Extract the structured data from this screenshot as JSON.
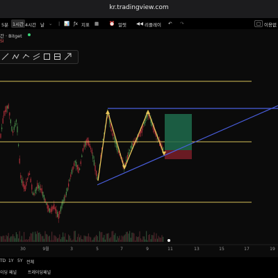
{
  "browser": {
    "url": "kr.tradingview.com"
  },
  "toolbar": {
    "items": [
      "5분",
      "1시간",
      "4시간",
      "날",
      "지표",
      "얼럿",
      "리플레이",
      "이용없"
    ],
    "active_index": 1
  },
  "symbol": {
    "label": "간 · Bitget",
    "sub": "SI"
  },
  "x_axis": {
    "ticks": [
      "30",
      "9월",
      "3",
      "5",
      "7",
      "9",
      "11",
      "13",
      "15",
      "17",
      "19"
    ]
  },
  "footer": {
    "ranges": [
      "TD",
      "1Y",
      "5Y",
      "전체"
    ],
    "panels": [
      "이딩 패널",
      "트레이딩패널"
    ]
  },
  "colors": {
    "background": "#0b0b0b",
    "horizontal_lines": "#d9c35a",
    "trendline": "#4a5fe0",
    "pattern_line": "#e8c45a",
    "candle_up": "#4a8a4a",
    "candle_down": "#b0303a",
    "target_zone": "#1f6b4c",
    "stop_zone": "#7a1f28"
  }
}
